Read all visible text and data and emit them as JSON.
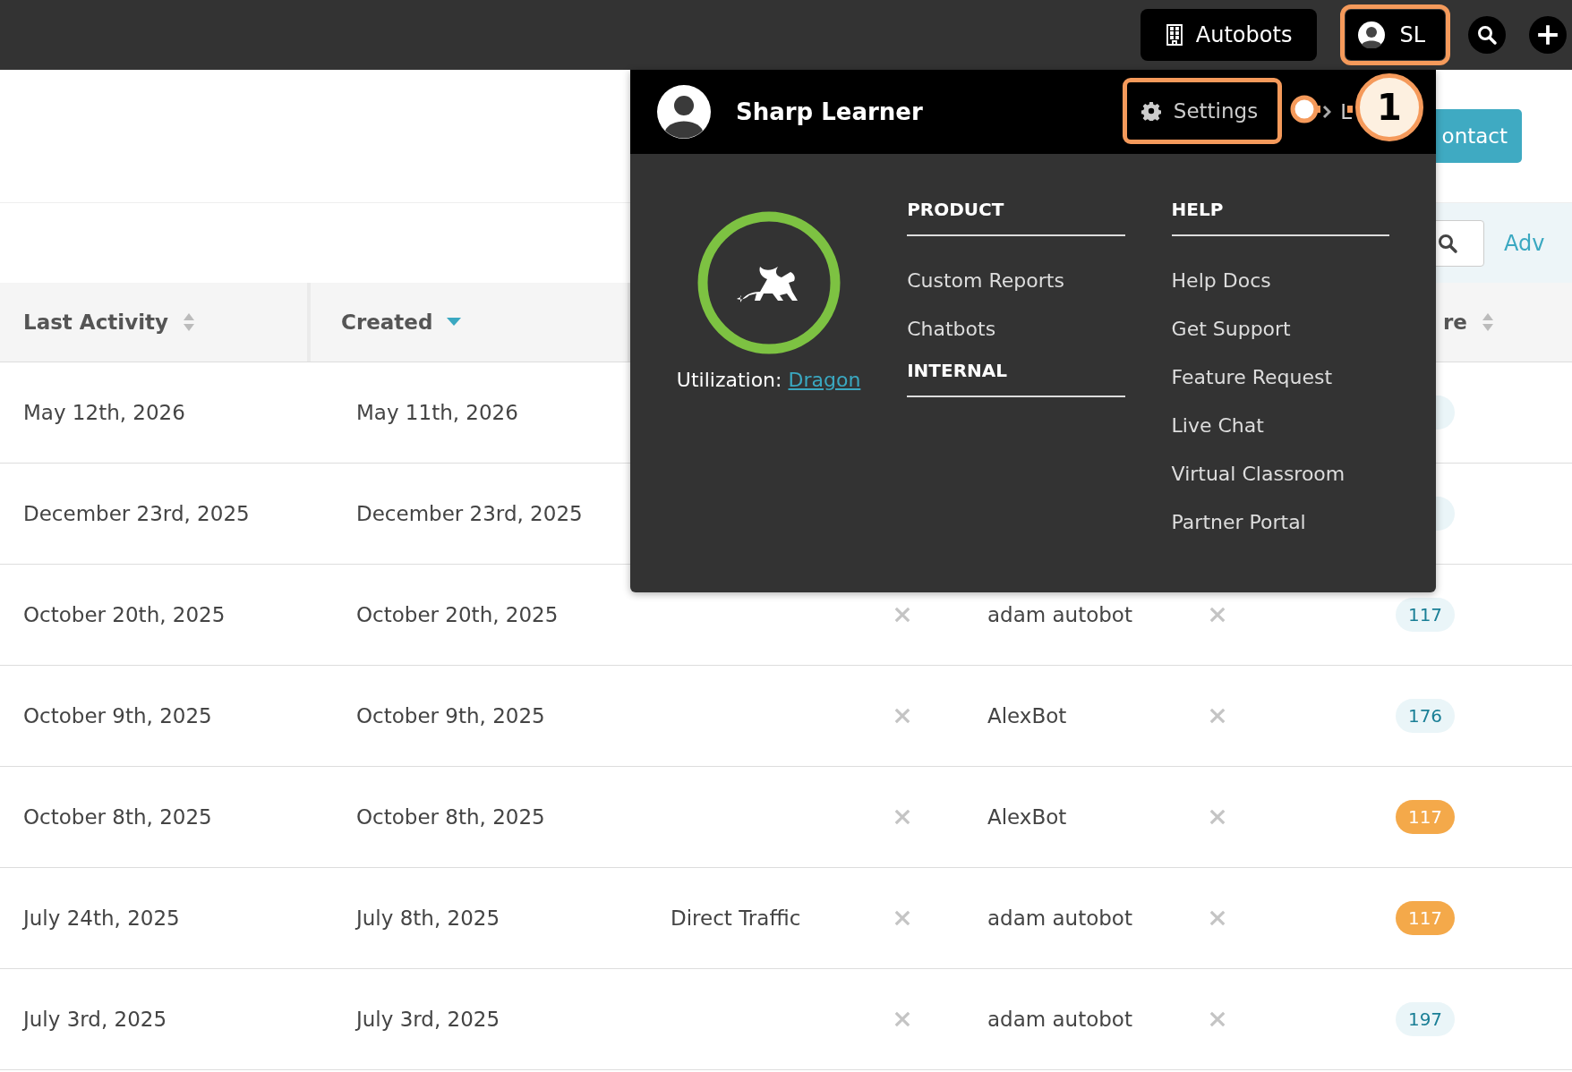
{
  "top_bar": {
    "workspace_button": "Autobots",
    "user_button": {
      "initials": "SL",
      "highlighted": true
    }
  },
  "page": {
    "contact_button": "ontact",
    "advanced_link": "Adv"
  },
  "table": {
    "columns": [
      {
        "label": "Last Activity",
        "sorted": false
      },
      {
        "label": "Created",
        "sorted": true
      },
      {
        "label": "re",
        "sorted": false
      }
    ],
    "rows": [
      {
        "last_activity": "May 12th, 2026",
        "created": "May 11th, 2026",
        "score": {
          "highlighted": false
        }
      },
      {
        "last_activity": "December 23rd, 2025",
        "created": "December 23rd, 2025",
        "score": {
          "highlighted": false
        }
      },
      {
        "last_activity": "October 20th, 2025",
        "created": "October 20th, 2025",
        "column_4": {
          "checked": false
        },
        "column_5": "adam autobot",
        "column_6": {
          "checked": false
        },
        "score": {
          "text": "117",
          "highlighted": false
        }
      },
      {
        "last_activity": "October 9th, 2025",
        "created": "October 9th, 2025",
        "column_4": {
          "checked": false
        },
        "column_5": "AlexBot",
        "column_6": {
          "checked": false
        },
        "score": {
          "text": "176",
          "highlighted": false
        }
      },
      {
        "last_activity": "October 8th, 2025",
        "created": "October 8th, 2025",
        "column_4": {
          "checked": false
        },
        "column_5": "AlexBot",
        "column_6": {
          "checked": false
        },
        "score": {
          "text": "117",
          "highlighted": true
        }
      },
      {
        "last_activity": "July 24th, 2025",
        "created": "July 8th, 2025",
        "column_3": "Direct Traffic",
        "column_4": {
          "checked": false
        },
        "column_5": "adam autobot",
        "column_6": {
          "checked": false
        },
        "score": {
          "text": "117",
          "highlighted": true
        }
      },
      {
        "last_activity": "July 3rd, 2025",
        "created": "July 3rd, 2025",
        "column_4": {
          "checked": false
        },
        "column_5": "adam autobot",
        "column_6": {
          "checked": false
        },
        "score": {
          "text": "197",
          "highlighted": false
        }
      }
    ]
  },
  "user_menu": {
    "name": "Sharp Learner",
    "settings": {
      "label": "Settings",
      "highlighted": true
    },
    "logout_partial": "L",
    "utilization_label": "Utilization: ",
    "utilization_link": "Dragon",
    "product_heading": "PRODUCT",
    "product_items": [
      "Custom Reports",
      "Chatbots"
    ],
    "internal_heading": "INTERNAL",
    "help_heading": "HELP",
    "help_items": [
      "Help Docs",
      "Get Support",
      "Feature Request",
      "Live Chat",
      "Virtual Classroom",
      "Partner Portal"
    ]
  },
  "callout": {
    "number": "1"
  }
}
